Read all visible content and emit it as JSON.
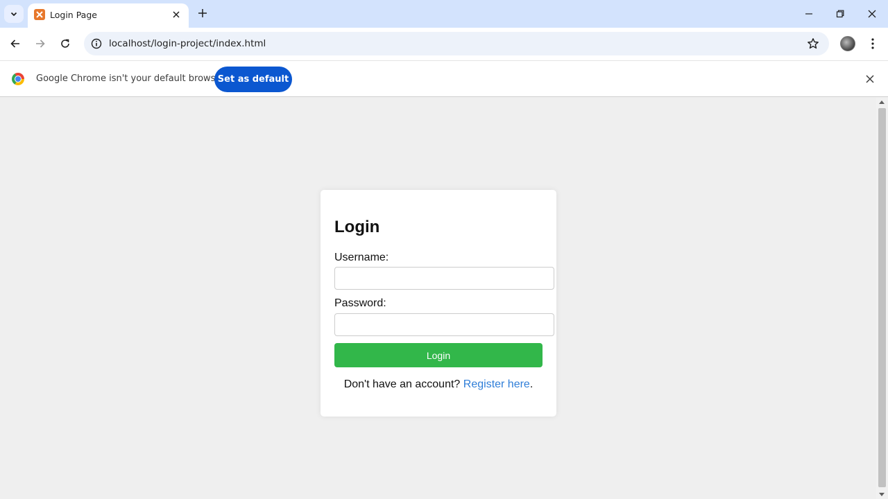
{
  "browser": {
    "tab": {
      "title": "Login Page"
    },
    "address_bar": {
      "url": "localhost/login-project/index.html"
    },
    "infobar": {
      "message": "Google Chrome isn't your default browser",
      "button_label": "Set as default"
    }
  },
  "login": {
    "heading": "Login",
    "username_label": "Username:",
    "username_value": "",
    "password_label": "Password:",
    "password_value": "",
    "submit_label": "Login",
    "register_prompt": "Don't have an account?",
    "register_link": "Register here",
    "register_suffix": "."
  },
  "colors": {
    "login_button": "#32b74a",
    "link": "#2f7ed8",
    "set_default_button": "#0b57d0",
    "tabstrip": "#d3e3fd"
  },
  "icons": [
    "tab-search-icon",
    "xampp-favicon-icon",
    "close-icon",
    "plus-icon",
    "minimize-icon",
    "restore-icon",
    "back-icon",
    "forward-icon",
    "reload-icon",
    "info-icon",
    "star-icon",
    "profile-avatar",
    "more-vert-icon",
    "chrome-logo-icon"
  ]
}
